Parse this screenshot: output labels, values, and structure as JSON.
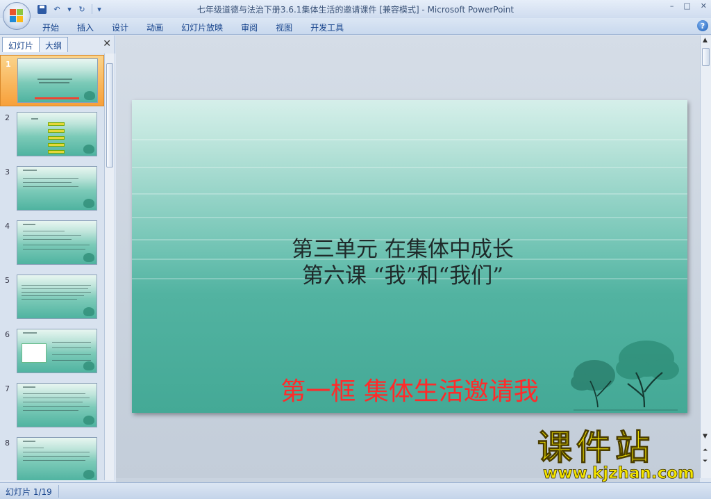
{
  "window": {
    "title": "七年级道德与法治下册3.6.1集体生活的邀请课件 [兼容模式] - Microsoft PowerPoint",
    "minimize": "–",
    "maximize": "□",
    "close": "✕"
  },
  "quick_access": {
    "save_icon": "save-icon",
    "undo_icon": "undo-icon",
    "redo_icon": "redo-icon",
    "customize_icon": "dropdown-icon"
  },
  "ribbon": {
    "tabs": [
      "开始",
      "插入",
      "设计",
      "动画",
      "幻灯片放映",
      "审阅",
      "视图",
      "开发工具"
    ],
    "help": "?"
  },
  "left_panel": {
    "tabs": [
      "幻灯片",
      "大纲"
    ],
    "close": "✕",
    "thumbnails": [
      "1",
      "2",
      "3",
      "4",
      "5",
      "6",
      "7",
      "8"
    ],
    "selected": 1
  },
  "slide": {
    "title_line1": "第三单元 在集体中成长",
    "title_line2": "第六课 “我”和“我们”",
    "subtitle": "第一框 集体生活邀请我",
    "background_top": "#d5efea",
    "background_bottom": "#44a996",
    "subtitle_color": "#ff2a2a"
  },
  "status_bar": {
    "slide_position": "幻灯片 1/19"
  },
  "watermark": {
    "logo_text": "课件站",
    "url": "www.kjzhan.com",
    "color": "#f6e600"
  }
}
